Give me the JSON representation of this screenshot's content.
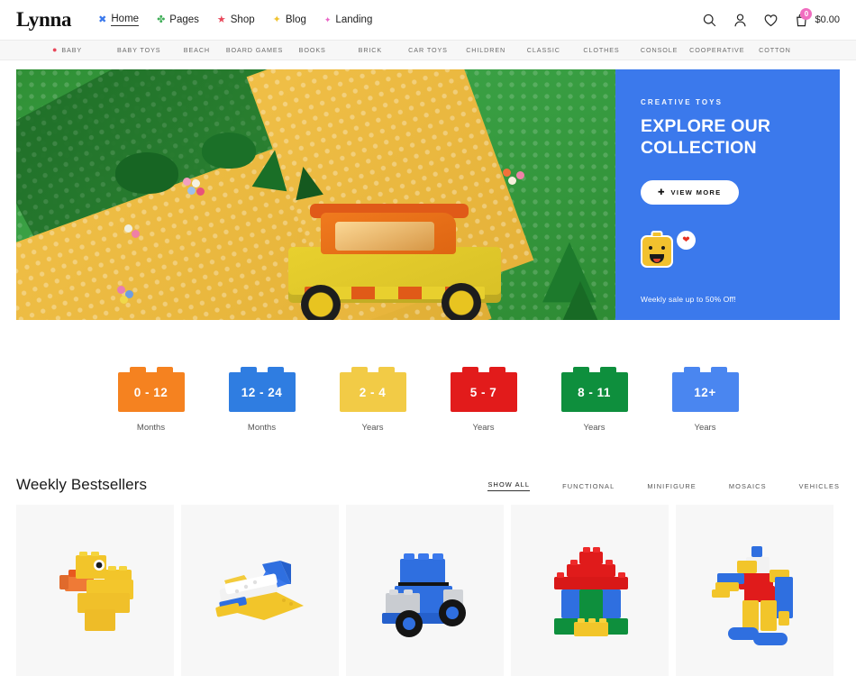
{
  "header": {
    "logo": "Lynna",
    "nav": [
      {
        "label": "Home",
        "icon": "sparkle-icon",
        "glyph": "✖",
        "color": "#3b79ec",
        "active": true
      },
      {
        "label": "Pages",
        "icon": "clover-icon",
        "glyph": "✤",
        "color": "#3fae57",
        "active": false
      },
      {
        "label": "Shop",
        "icon": "star-icon",
        "glyph": "★",
        "color": "#e8475a",
        "active": false
      },
      {
        "label": "Blog",
        "icon": "four-point-star-icon",
        "glyph": "✦",
        "color": "#f0c330",
        "active": false
      },
      {
        "label": "Landing",
        "icon": "small-star-icon",
        "glyph": "✦",
        "color": "#e965c6",
        "active": false
      }
    ],
    "tools": [
      {
        "name": "search-icon"
      },
      {
        "name": "user-account-icon"
      },
      {
        "name": "wishlist-heart-icon"
      }
    ],
    "cart": {
      "icon": "shopping-cart-icon",
      "count": "0",
      "total": "$0.00",
      "badge_color": "#f06ec0"
    }
  },
  "categories": [
    "Baby",
    "Baby Toys",
    "Beach",
    "Board Games",
    "Books",
    "Brick",
    "Car Toys",
    "Children",
    "Classic",
    "Clothes",
    "Console",
    "Cooperative",
    "Cotton"
  ],
  "hero": {
    "image_alt": "lego-landscape-with-offroad-car-scene",
    "eyebrow": "Creative Toys",
    "title_line1": "Explore Our",
    "title_line2": "Collection",
    "cta": "View More",
    "cta_icon": "plus-icon",
    "mini_icon": "lego-minifigure-head-icon",
    "bubble_icon": "heart-icon",
    "sale_text": "Weekly sale up to 50% Off!",
    "panel_color": "#3b79ec"
  },
  "age_groups": [
    {
      "range": "0 - 12",
      "unit": "Months",
      "color": "#f58220",
      "stud_color": "#f58220"
    },
    {
      "range": "12 - 24",
      "unit": "Months",
      "color": "#2f7de1",
      "stud_color": "#2f7de1"
    },
    {
      "range": "2 - 4",
      "unit": "Years",
      "color": "#f2cb46",
      "stud_color": "#f2cb46"
    },
    {
      "range": "5 - 7",
      "unit": "Years",
      "color": "#e21b1b",
      "stud_color": "#e21b1b"
    },
    {
      "range": "8 - 11",
      "unit": "Years",
      "color": "#0e8f3d",
      "stud_color": "#0e8f3d"
    },
    {
      "range": "12+",
      "unit": "Years",
      "color": "#4a86f0",
      "stud_color": "#4a86f0"
    }
  ],
  "bestsellers": {
    "title": "Weekly Bestsellers",
    "filters": [
      {
        "label": "Show All",
        "active": true
      },
      {
        "label": "Functional",
        "active": false
      },
      {
        "label": "Minifigure",
        "active": false
      },
      {
        "label": "Mosaics",
        "active": false
      },
      {
        "label": "Vehicles",
        "active": false
      }
    ],
    "products": [
      {
        "name": "lego-duck-product",
        "alt": "Yellow lego brick duck"
      },
      {
        "name": "lego-airplane-product",
        "alt": "Yellow white and blue lego airplane"
      },
      {
        "name": "lego-truck-product",
        "alt": "Blue lego truck with black wheels"
      },
      {
        "name": "lego-house-product",
        "alt": "Colorful lego house with red roof"
      },
      {
        "name": "lego-robot-product",
        "alt": "Red yellow and blue lego robot"
      }
    ]
  }
}
